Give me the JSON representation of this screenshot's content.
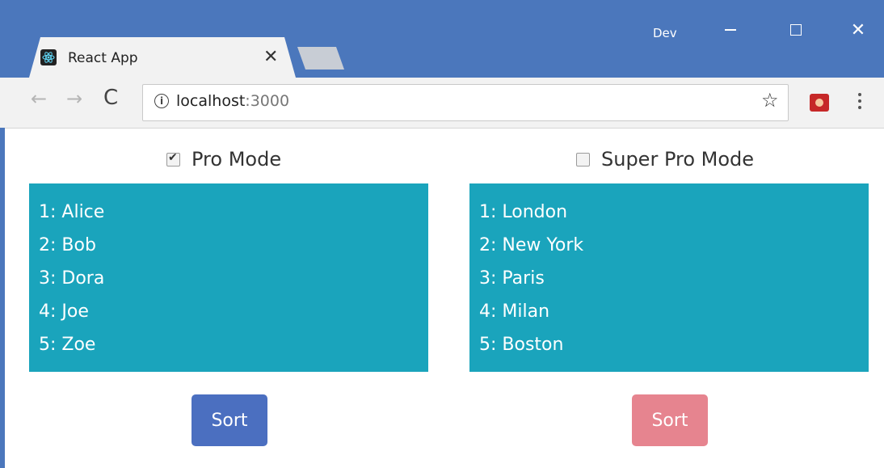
{
  "window": {
    "profile_name": "Dev",
    "minimize_icon": "minimize-icon",
    "maximize_icon": "maximize-icon",
    "close_glyph": "✕"
  },
  "tab": {
    "title": "React App",
    "favicon": "react-logo-icon",
    "close_glyph": "✕"
  },
  "toolbar": {
    "back_glyph": "←",
    "forward_glyph": "→",
    "reload_glyph": "C",
    "url_host": "localhost",
    "url_port": ":3000",
    "info_glyph": "i",
    "bookmark_glyph": "☆"
  },
  "left_panel": {
    "checkbox_label": "Pro Mode",
    "checked": true,
    "items": [
      "1: Alice",
      "2: Bob",
      "3: Dora",
      "4: Joe",
      "5: Zoe"
    ],
    "button_label": "Sort",
    "button_color": "#4b6fc0"
  },
  "right_panel": {
    "checkbox_label": "Super Pro Mode",
    "checked": false,
    "items": [
      "1: London",
      "2: New York",
      "3: Paris",
      "4: Milan",
      "5: Boston"
    ],
    "button_label": "Sort",
    "button_color": "#e6848f"
  },
  "colors": {
    "titlebar": "#4b77bc",
    "list_bg": "#1aa4bc"
  }
}
